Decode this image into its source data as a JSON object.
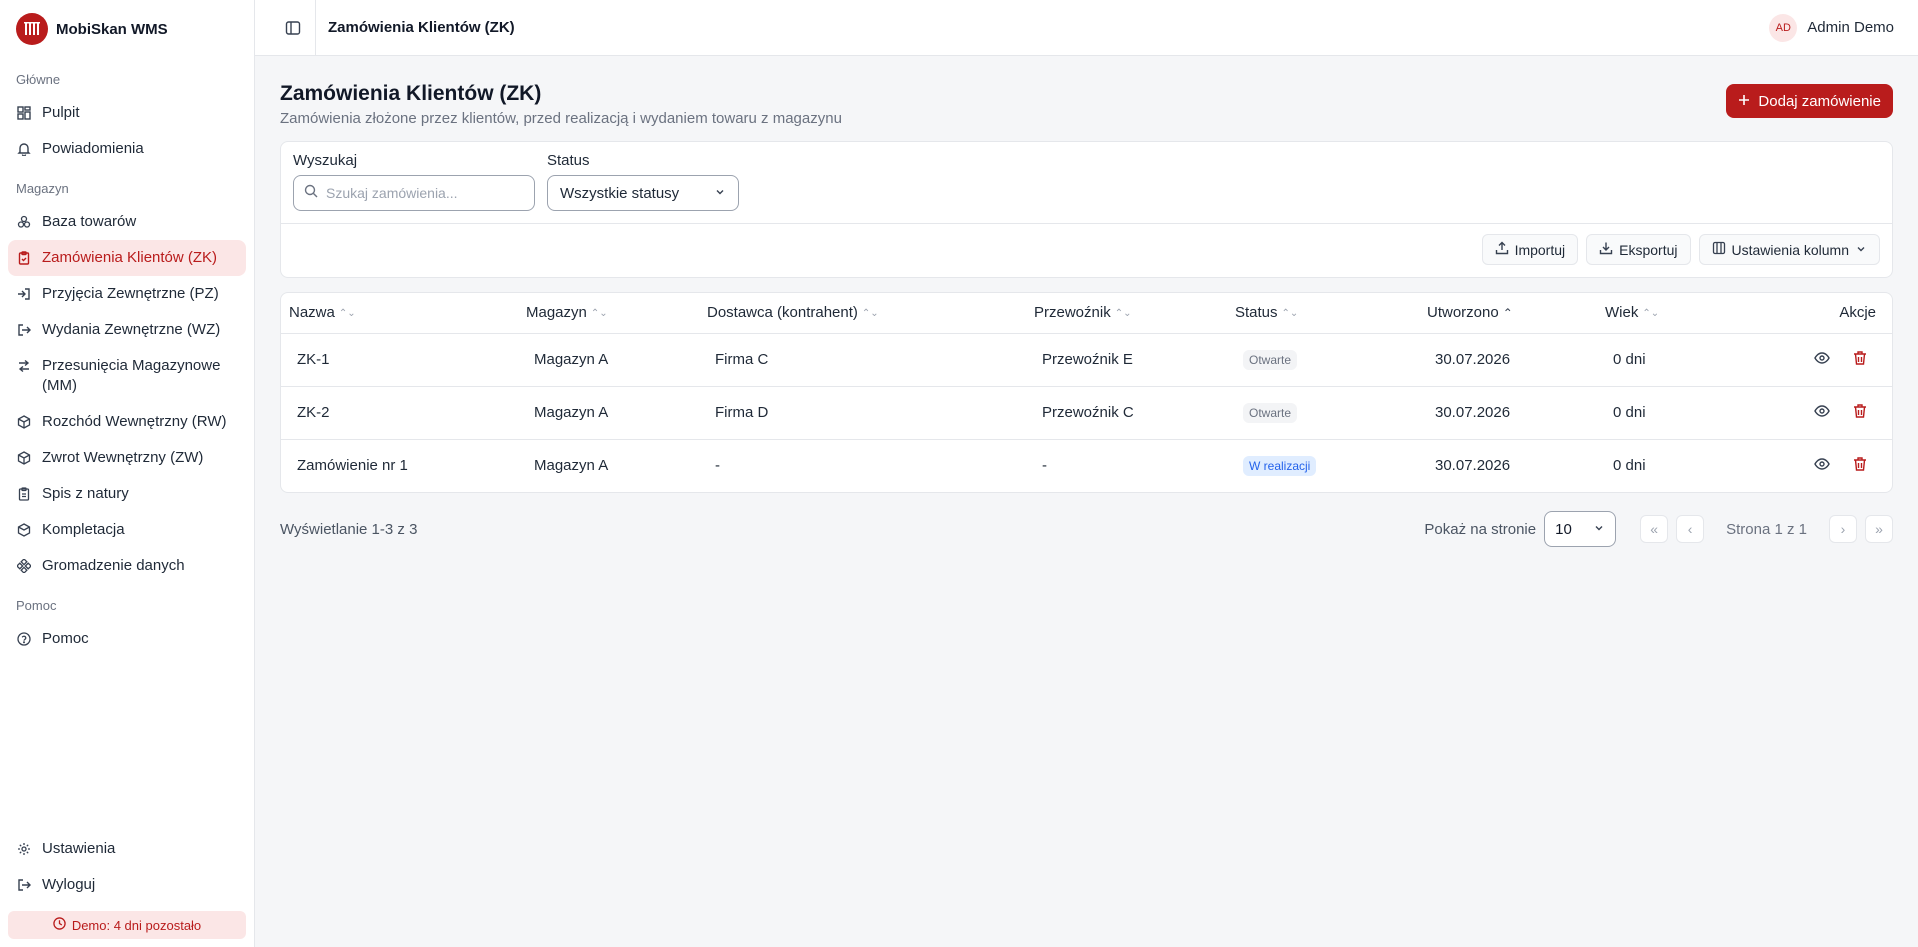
{
  "app": {
    "name": "MobiSkan WMS"
  },
  "sidebar": {
    "sections": [
      {
        "label": "Główne",
        "items": [
          {
            "label": "Pulpit",
            "icon": "dashboard-icon"
          },
          {
            "label": "Powiadomienia",
            "icon": "bell-icon"
          }
        ]
      },
      {
        "label": "Magazyn",
        "items": [
          {
            "label": "Baza towarów",
            "icon": "boxes-icon"
          },
          {
            "label": "Zamówienia Klientów (ZK)",
            "icon": "clipboard-icon",
            "active": true
          },
          {
            "label": "Przyjęcia Zewnętrzne (PZ)",
            "icon": "login-icon"
          },
          {
            "label": "Wydania Zewnętrzne (WZ)",
            "icon": "logout-icon"
          },
          {
            "label": "Przesunięcia Magazynowe (MM)",
            "icon": "arrows-icon"
          },
          {
            "label": "Rozchód Wewnętrzny (RW)",
            "icon": "package-icon"
          },
          {
            "label": "Zwrot Wewnętrzny (ZW)",
            "icon": "package-icon"
          },
          {
            "label": "Spis z natury",
            "icon": "clipboard-list-icon"
          },
          {
            "label": "Kompletacja",
            "icon": "layers-icon"
          },
          {
            "label": "Gromadzenie danych",
            "icon": "network-icon"
          }
        ]
      },
      {
        "label": "Pomoc",
        "items": [
          {
            "label": "Pomoc",
            "icon": "help-icon"
          }
        ]
      }
    ],
    "bottom": [
      {
        "label": "Ustawienia",
        "icon": "gear-icon"
      },
      {
        "label": "Wyloguj",
        "icon": "logout-icon"
      }
    ],
    "demo": "Demo: 4 dni pozostało"
  },
  "topbar": {
    "title": "Zamówienia Klientów (ZK)",
    "avatar": "AD",
    "user": "Admin Demo"
  },
  "page": {
    "title": "Zamówienia Klientów (ZK)",
    "subtitle": "Zamówienia złożone przez klientów, przed realizacją i wydaniem towaru z magazynu",
    "add_label": "Dodaj zamówienie"
  },
  "filters": {
    "search_label": "Wyszukaj",
    "search_placeholder": "Szukaj zamówienia...",
    "status_label": "Status",
    "status_value": "Wszystkie statusy",
    "import_label": "Importuj",
    "export_label": "Eksportuj",
    "columns_label": "Ustawienia kolumn"
  },
  "table": {
    "columns": [
      "Nazwa",
      "Magazyn",
      "Dostawca (kontrahent)",
      "Przewoźnik",
      "Status",
      "Utworzono",
      "Wiek",
      "Akcje"
    ],
    "rows": [
      {
        "name": "ZK-1",
        "warehouse": "Magazyn A",
        "supplier": "Firma C",
        "carrier": "Przewoźnik E",
        "status": "Otwarte",
        "status_type": "gray",
        "created": "30.07.2026",
        "age": "0 dni"
      },
      {
        "name": "ZK-2",
        "warehouse": "Magazyn A",
        "supplier": "Firma D",
        "carrier": "Przewoźnik C",
        "status": "Otwarte",
        "status_type": "gray",
        "created": "30.07.2026",
        "age": "0 dni"
      },
      {
        "name": "Zamówienie nr 1",
        "warehouse": "Magazyn A",
        "supplier": "-",
        "carrier": "-",
        "status": "W realizacji",
        "status_type": "blue",
        "created": "30.07.2026",
        "age": "0 dni"
      }
    ]
  },
  "pagination": {
    "summary": "Wyświetlanie 1-3 z 3",
    "per_page_label": "Pokaż na stronie",
    "per_page_value": "10",
    "page_text": "Strona 1 z 1"
  },
  "colors": {
    "accent": "#b91c1c",
    "accent_soft": "#fbe6e6",
    "info": "#2563eb"
  }
}
